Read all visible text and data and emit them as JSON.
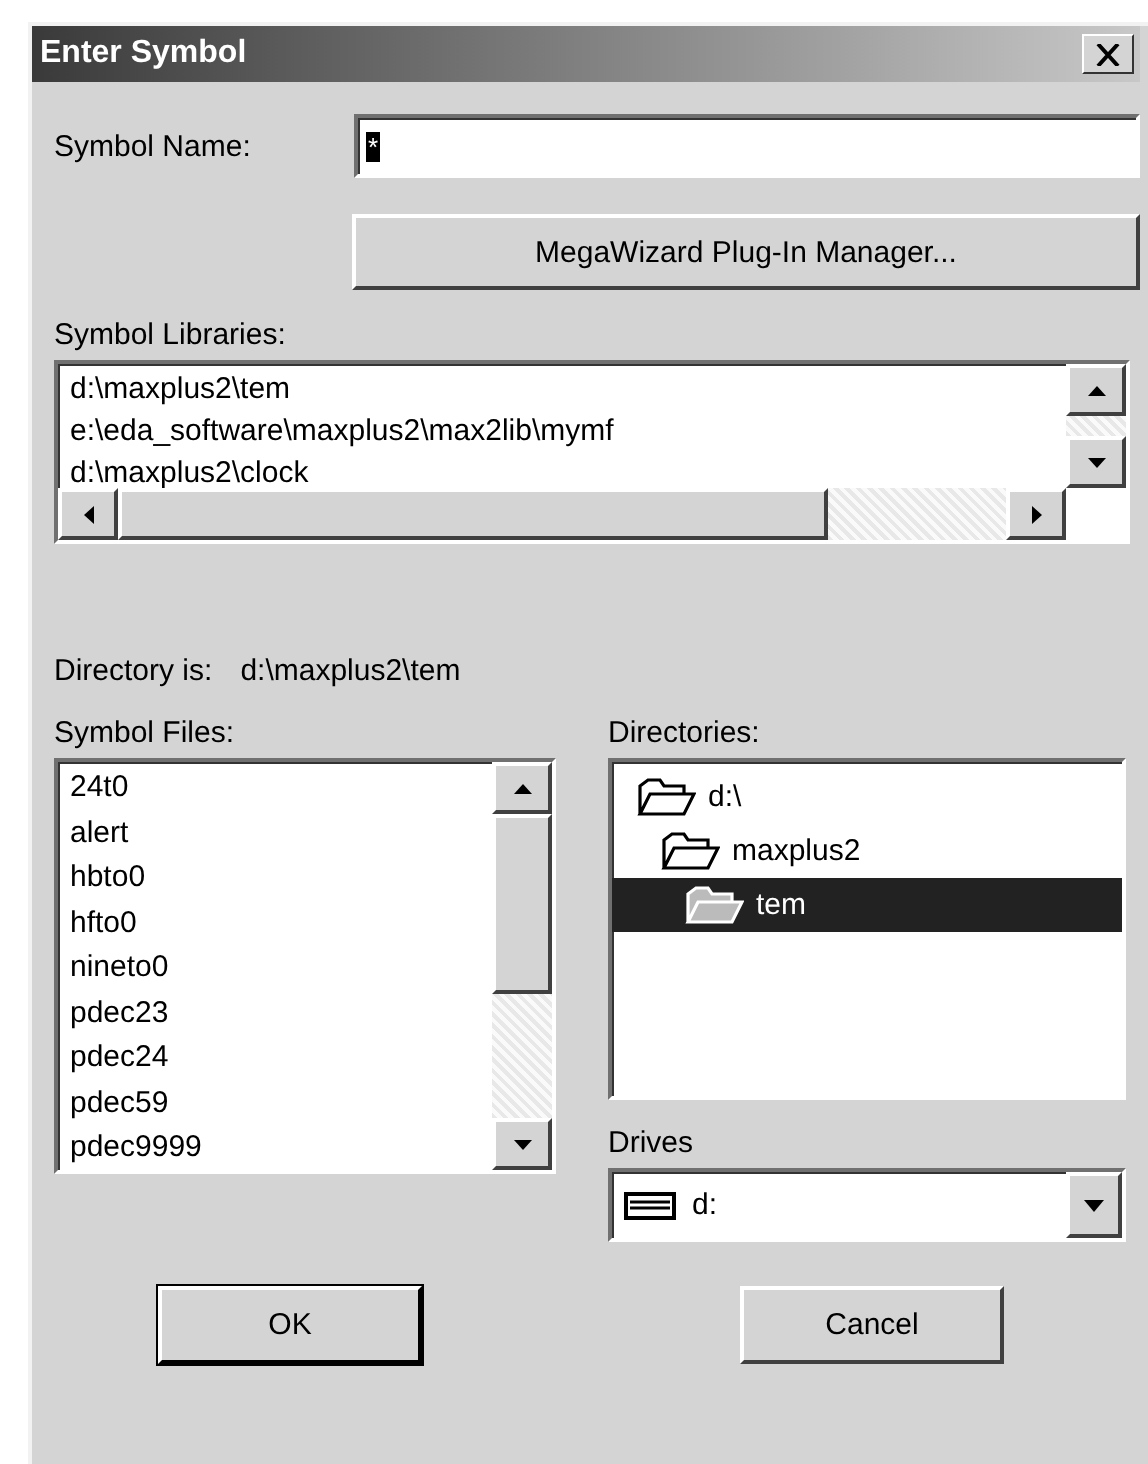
{
  "window": {
    "title": "Enter Symbol"
  },
  "symbol_name": {
    "label": "Symbol Name:",
    "value": "*"
  },
  "megawizard_button": {
    "label": "MegaWizard Plug-In Manager..."
  },
  "symbol_libraries": {
    "label": "Symbol Libraries:",
    "items": [
      "d:\\maxplus2\\tem",
      "e:\\eda_software\\maxplus2\\max2lib\\mymf",
      "d:\\maxplus2\\clock"
    ]
  },
  "directory": {
    "label": "Directory is:",
    "path": "d:\\maxplus2\\tem"
  },
  "symbol_files": {
    "label": "Symbol Files:",
    "items": [
      "24t0",
      "alert",
      "hbto0",
      "hfto0",
      "nineto0",
      "pdec23",
      "pdec24",
      "pdec59",
      "pdec9999"
    ]
  },
  "directories": {
    "label": "Directories:",
    "items": [
      {
        "name": "d:\\",
        "selected": false,
        "children": [
          {
            "name": "maxplus2",
            "selected": false,
            "children": [
              {
                "name": "tem",
                "selected": true
              }
            ]
          }
        ]
      }
    ]
  },
  "drives": {
    "label": "Drives",
    "value": "d:"
  },
  "buttons": [
    {
      "label": "OK",
      "default": true
    },
    {
      "label": "Cancel",
      "default": false
    }
  ]
}
